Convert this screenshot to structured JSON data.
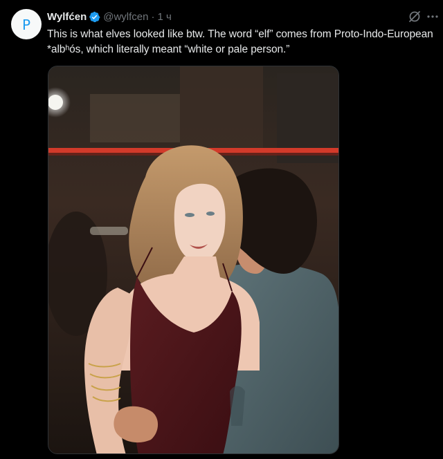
{
  "author": {
    "display_name": "Wylfćen",
    "handle": "@wylfcen",
    "separator": "·",
    "time": "1 ч",
    "avatar_letter": "P",
    "verified": true
  },
  "tweet": {
    "text": "This is what elves looked like btw. The word “elf” comes from Proto-Indo-European *albʰós, which literally meant “white or pale person.”"
  },
  "icons": {
    "verified": "verified-badge-icon",
    "grok": "grok-icon",
    "more": "more-icon"
  },
  "colors": {
    "background": "#000000",
    "text": "#e7e9ea",
    "muted": "#71767b",
    "verified": "#1d9bf0",
    "avatar_glyph": "#1d9bf0"
  }
}
